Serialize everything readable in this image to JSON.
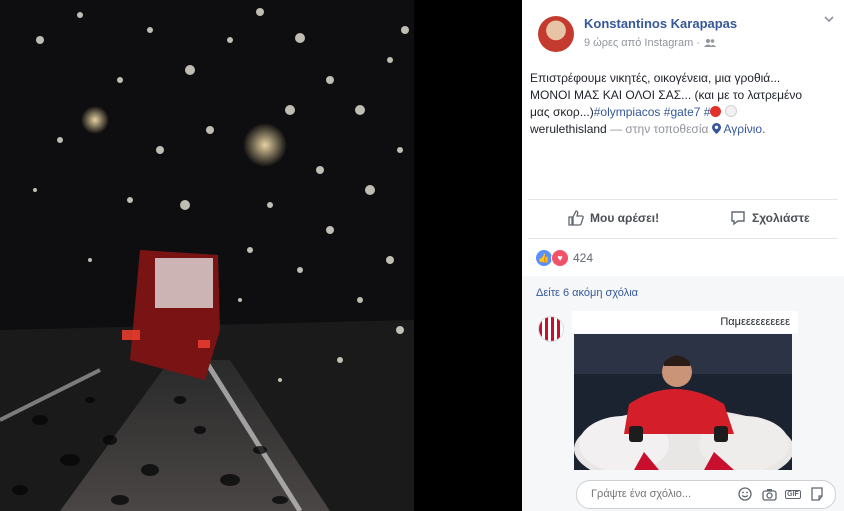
{
  "post": {
    "author": "Konstantinos Karapapas",
    "meta": "9 ώρες από Instagram ·",
    "text_line1": "Επιστρέφουμε νικητές, οικογένεια, μια γροθιά...",
    "text_line2": "ΜΟΝΟΙ ΜΑΣ ΚΑΙ ΟΛΟΙ ΣΑΣ... (και με το λατρεμένο",
    "text_line3_prefix": "μας σκορ...)",
    "hashtags": "#olympiacos #gate7 #",
    "handle": "werulethisland",
    "location_prefix": "— στην τοποθεσία",
    "location": "Αγρίνιο."
  },
  "actions": {
    "like_label": "Μου αρέσει!",
    "comment_label": "Σχολιάστε"
  },
  "reactions": {
    "count": "424"
  },
  "comments": {
    "more_label": "Δείτε 6 ακόμη σχόλια",
    "first_text": "Παμεεεεεεεεεε"
  },
  "compose": {
    "placeholder": "Γράψτε ένα σχόλιο..."
  },
  "colors": {
    "link": "#365899",
    "like_blue": "#5890ff",
    "love_red": "#f25268",
    "olympiacos_red": "#c8102e"
  },
  "icons": [
    "chevron-down-icon",
    "friends-icon",
    "thumbs-up-icon",
    "comment-icon",
    "location-pin-icon",
    "emoji-icon",
    "camera-icon",
    "gif-icon",
    "sticker-icon"
  ]
}
